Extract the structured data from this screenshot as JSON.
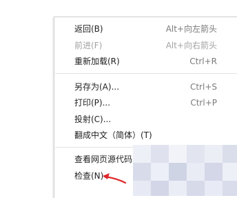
{
  "menu": {
    "items": [
      {
        "label": "返回(B)",
        "shortcut": "Alt+向左箭头"
      },
      {
        "label": "前进(F)",
        "shortcut": "Alt+向右箭头"
      },
      {
        "label": "重新加载(R)",
        "shortcut": "Ctrl+R"
      },
      {
        "label": "另存为(A)...",
        "shortcut": "Ctrl+S"
      },
      {
        "label": "打印(P)...",
        "shortcut": "Ctrl+P"
      },
      {
        "label": "投射(C)...",
        "shortcut": ""
      },
      {
        "label": "翻成中文（简体）(T)",
        "shortcut": ""
      },
      {
        "label": "查看网页源代码(",
        "shortcut": ""
      },
      {
        "label": "检查(N)",
        "shortcut": ""
      }
    ]
  },
  "annotation": {
    "arrow_color": "#e0262b"
  }
}
